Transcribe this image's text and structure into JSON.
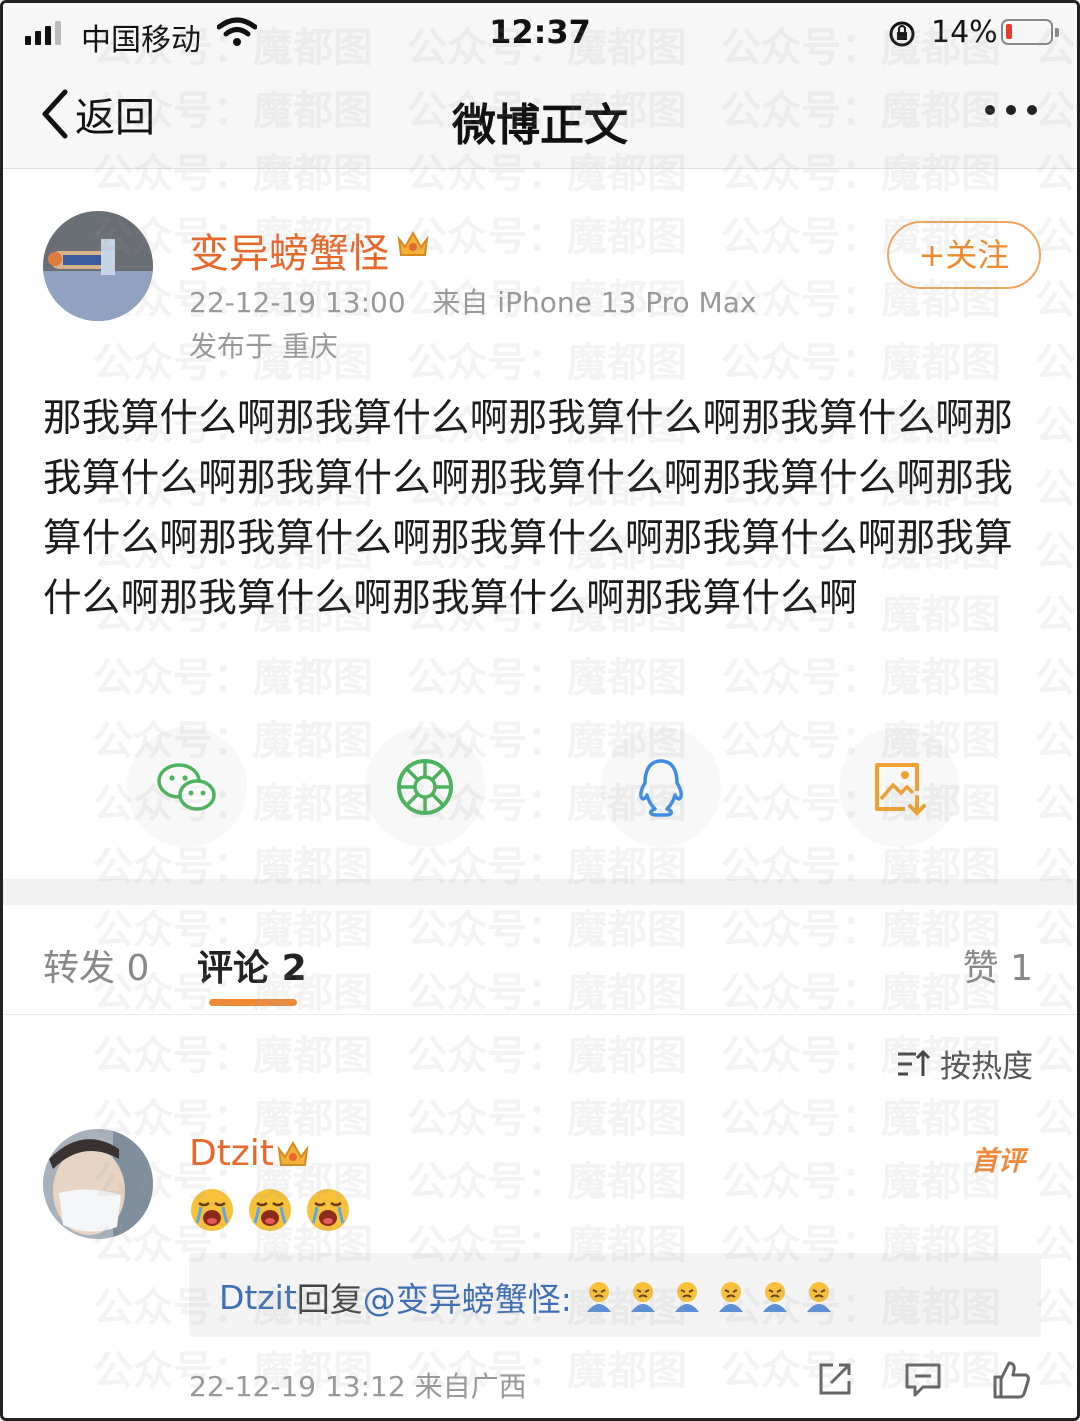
{
  "status_bar": {
    "carrier": "中国移动",
    "time": "12:37",
    "battery_percent": "14%",
    "battery_level": 0.14,
    "icons": [
      "signal-icon",
      "wifi-icon",
      "orientation-lock-icon",
      "battery-icon"
    ]
  },
  "nav": {
    "back_label": "返回",
    "title": "微博正文",
    "more_icon": "more-icon"
  },
  "post": {
    "author": "变异螃蟹怪",
    "timestamp": "22-12-19 13:00",
    "source": "来自 iPhone 13 Pro Max",
    "location": "发布于 重庆",
    "follow_label": "+关注",
    "text": "那我算什么啊那我算什么啊那我算什么啊那我算什么啊那我算什么啊那我算什么啊那我算什么啊那我算什么啊那我算什么啊那我算什么啊那我算什么啊那我算什么啊那我算什么啊那我算什么啊那我算什么啊那我算什么啊"
  },
  "share": [
    "wechat-icon",
    "moments-icon",
    "qq-icon",
    "save-image-icon"
  ],
  "tabs": {
    "repost_label": "转发",
    "repost_count": "0",
    "comment_label": "评论",
    "comment_count": "2",
    "like_label": "赞",
    "like_count": "1"
  },
  "sort_label": "按热度",
  "comment": {
    "author": "Dtzit",
    "first_badge": "首评",
    "emoji_count": 3,
    "reply": {
      "author": "Dtzit",
      "verb": "回复",
      "mention": "@变异螃蟹怪:",
      "emoji_count": 6
    },
    "timestamp": "22-12-19 13:12",
    "source": "来自广西"
  },
  "watermark": "公众号：魔都图",
  "colors": {
    "accent_orange": "#e8672a",
    "link_blue": "#3d6fb4",
    "meta_gray": "#999999"
  }
}
